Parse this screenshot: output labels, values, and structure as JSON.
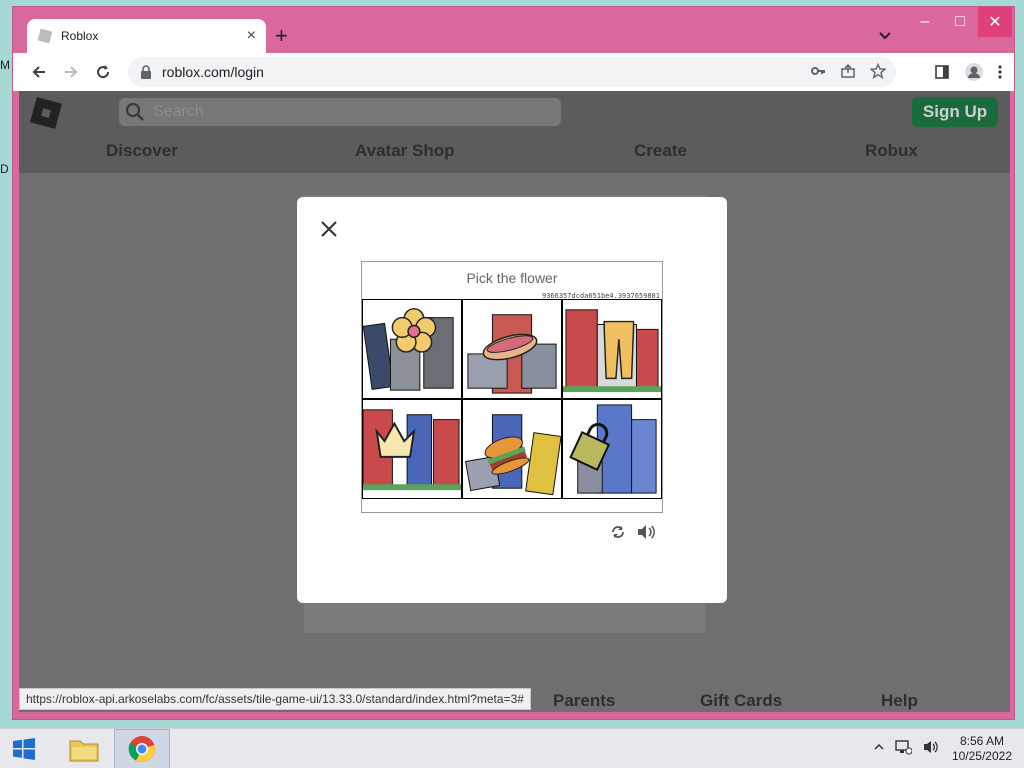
{
  "desktop": {
    "letters": [
      "M",
      "D"
    ]
  },
  "browser": {
    "tab_title": "Roblox",
    "tab_close": "×",
    "new_tab": "+",
    "url": "roblox.com/login",
    "window_controls": [
      "–",
      "□",
      "✕"
    ]
  },
  "roblox": {
    "search_placeholder": "Search",
    "signup_label": "Sign Up",
    "nav": [
      "Discover",
      "Avatar Shop",
      "Create",
      "Robux"
    ],
    "footer": [
      "Parents",
      "Gift Cards",
      "Help"
    ]
  },
  "statusbar": {
    "url": "https://roblox-api.arkoselabs.com/fc/assets/tile-game-ui/13.33.0/standard/index.html?meta=3#"
  },
  "captcha": {
    "title": "Pick the flower",
    "id": "9366357dcda651be4.3937659801",
    "tiles": [
      {
        "object": "flower-icon"
      },
      {
        "object": "hotdog-icon"
      },
      {
        "object": "pants-icon"
      },
      {
        "object": "crown-icon"
      },
      {
        "object": "burger-icon"
      },
      {
        "object": "bag-icon"
      }
    ]
  },
  "taskbar": {
    "time": "8:56 AM",
    "date": "10/25/2022"
  },
  "colors": {
    "window_frame": "#d9689c",
    "signup_button": "#1a6a3c",
    "overlay": "#6f6f6f"
  }
}
